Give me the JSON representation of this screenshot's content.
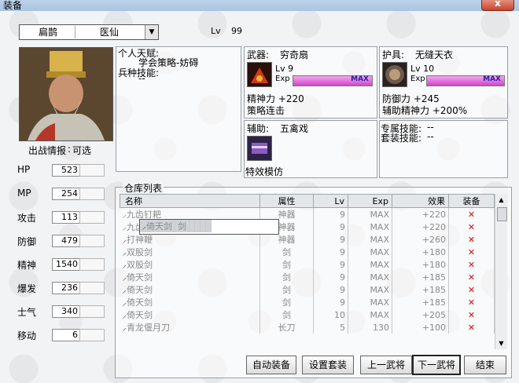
{
  "window": {
    "title": "装备",
    "close": "x"
  },
  "selector": {
    "faction": "扁鹊",
    "class": "医仙"
  },
  "level": {
    "label": "Lv",
    "value": "99"
  },
  "dispatch": {
    "label": "出战情报",
    "value": "可选"
  },
  "stats": [
    {
      "label": "HP",
      "value": "523"
    },
    {
      "label": "MP",
      "value": "254"
    },
    {
      "label": "攻击",
      "value": "113"
    },
    {
      "label": "防御",
      "value": "479"
    },
    {
      "label": "精神",
      "value": "1540"
    },
    {
      "label": "爆发",
      "value": "236"
    },
    {
      "label": "士气",
      "value": "340"
    },
    {
      "label": "移动",
      "value": "6"
    }
  ],
  "talent": {
    "label": "个人天赋:",
    "value": "学会策略-妨碍",
    "skill_label": "兵种技能:",
    "skill_value": "--"
  },
  "weapon": {
    "label": "武器:",
    "name": "穷奇扇",
    "lv": "Lv 9",
    "exp": "Exp",
    "max": "MAX",
    "bonus1": "精神力 +220",
    "bonus2": "策略连击",
    "exp_fraction": 1.0
  },
  "armor": {
    "label": "护具:",
    "name": "无缝天衣",
    "lv": "Lv 10",
    "exp": "Exp",
    "max": "MAX",
    "bonus1": "防御力 +245",
    "bonus2": "辅助精神力 +200%",
    "exp_fraction": 1.0
  },
  "assist": {
    "label": "辅助:",
    "name": "五禽戏",
    "effect": "特效模仿"
  },
  "exclusive": {
    "label1": "专属技能:",
    "value1": "--",
    "label2": "套装技能:",
    "value2": "--"
  },
  "inventory": {
    "label": "仓库列表",
    "headers": [
      "名称",
      "属性",
      "Lv",
      "Exp",
      "效果",
      "装备"
    ],
    "rows": [
      {
        "name": "九齿钉耙",
        "attr": "神器",
        "lv": "9",
        "exp": "MAX",
        "effect": "+220",
        "equip": "✕"
      },
      {
        "name": "九齿钉耙",
        "attr": "神器",
        "lv": "9",
        "exp": "MAX",
        "effect": "+220",
        "equip": "✕"
      },
      {
        "name": "打神鞭",
        "attr": "神器",
        "lv": "9",
        "exp": "MAX",
        "effect": "+260",
        "equip": "✕"
      },
      {
        "name": "双股剑",
        "attr": "剑",
        "lv": "9",
        "exp": "MAX",
        "effect": "+180",
        "equip": "✕"
      },
      {
        "name": "双股剑",
        "attr": "剑",
        "lv": "9",
        "exp": "MAX",
        "effect": "+180",
        "equip": "✕"
      },
      {
        "name": "倚天剑",
        "attr": "剑",
        "lv": "9",
        "exp": "MAX",
        "effect": "+185",
        "equip": "✕"
      },
      {
        "name": "倚天剑",
        "attr": "剑",
        "lv": "9",
        "exp": "MAX",
        "effect": "+185",
        "equip": "✕"
      },
      {
        "name": "倚天剑",
        "attr": "剑",
        "lv": "9",
        "exp": "MAX",
        "effect": "+185",
        "equip": "✕"
      },
      {
        "name": "倚天剑",
        "attr": "剑",
        "lv": "",
        "exp": "",
        "effect": "",
        "equip": ""
      },
      {
        "name": "倚天剑",
        "attr": "剑",
        "lv": "10",
        "exp": "MAX",
        "effect": "+205",
        "equip": "✕"
      },
      {
        "name": "青龙偃月刀",
        "attr": "长刀",
        "lv": "5",
        "exp": "130",
        "effect": "+100",
        "equip": "✕"
      }
    ]
  },
  "buttons": {
    "auto": "自动装备",
    "set": "设置套装",
    "prev": "上一武将",
    "next": "下一武将",
    "end": "结束"
  },
  "colors": {
    "exp_bar": "#d046c8",
    "max_text": "#2a22a0",
    "equip_x": "#d01010"
  }
}
